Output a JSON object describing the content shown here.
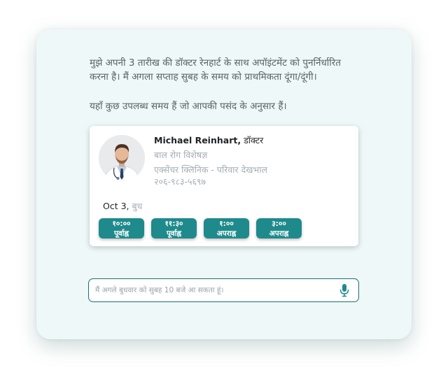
{
  "chat": {
    "user_message": "मुझे अपनी 3 तारीख की डॉक्टर रेनहार्ट के साथ अपॉइंटमेंट को पुनर्निर्धारित करना है। मैं अगला सप्ताह सुबह के समय को प्राथमिकता दूंगा/दूंगी।",
    "assistant_message": "यहाँ कुछ उपलब्ध समय हैं जो आपकी पसंद के अनुसार हैं।"
  },
  "doctor_card": {
    "name": "Michael Reinhart,",
    "title": " डॉक्टर",
    "specialty": "बाल रोग विशेषज्ञ",
    "clinic": "एक्सेंचर क्लिनिक - परिवार देखभाल",
    "phone": "२०६-९८३-५६९७",
    "avatar_icon": "doctor-portrait",
    "date": "Oct 3,",
    "weekday": "बुध",
    "slots": [
      "१०:०० पूर्वाह्न",
      "११:३० पूर्वाह्न",
      "१:०० अपराह्न",
      "३:०० अपराह्न"
    ]
  },
  "composer": {
    "placeholder": "मैं अगले बुधवार को सुबह 10 बजे आ सकता हूं।",
    "mic_icon": "microphone-icon"
  },
  "colors": {
    "accent": "#1f8a8c",
    "panel_bg": "#eef8f8",
    "input_border": "#1b6f73"
  }
}
